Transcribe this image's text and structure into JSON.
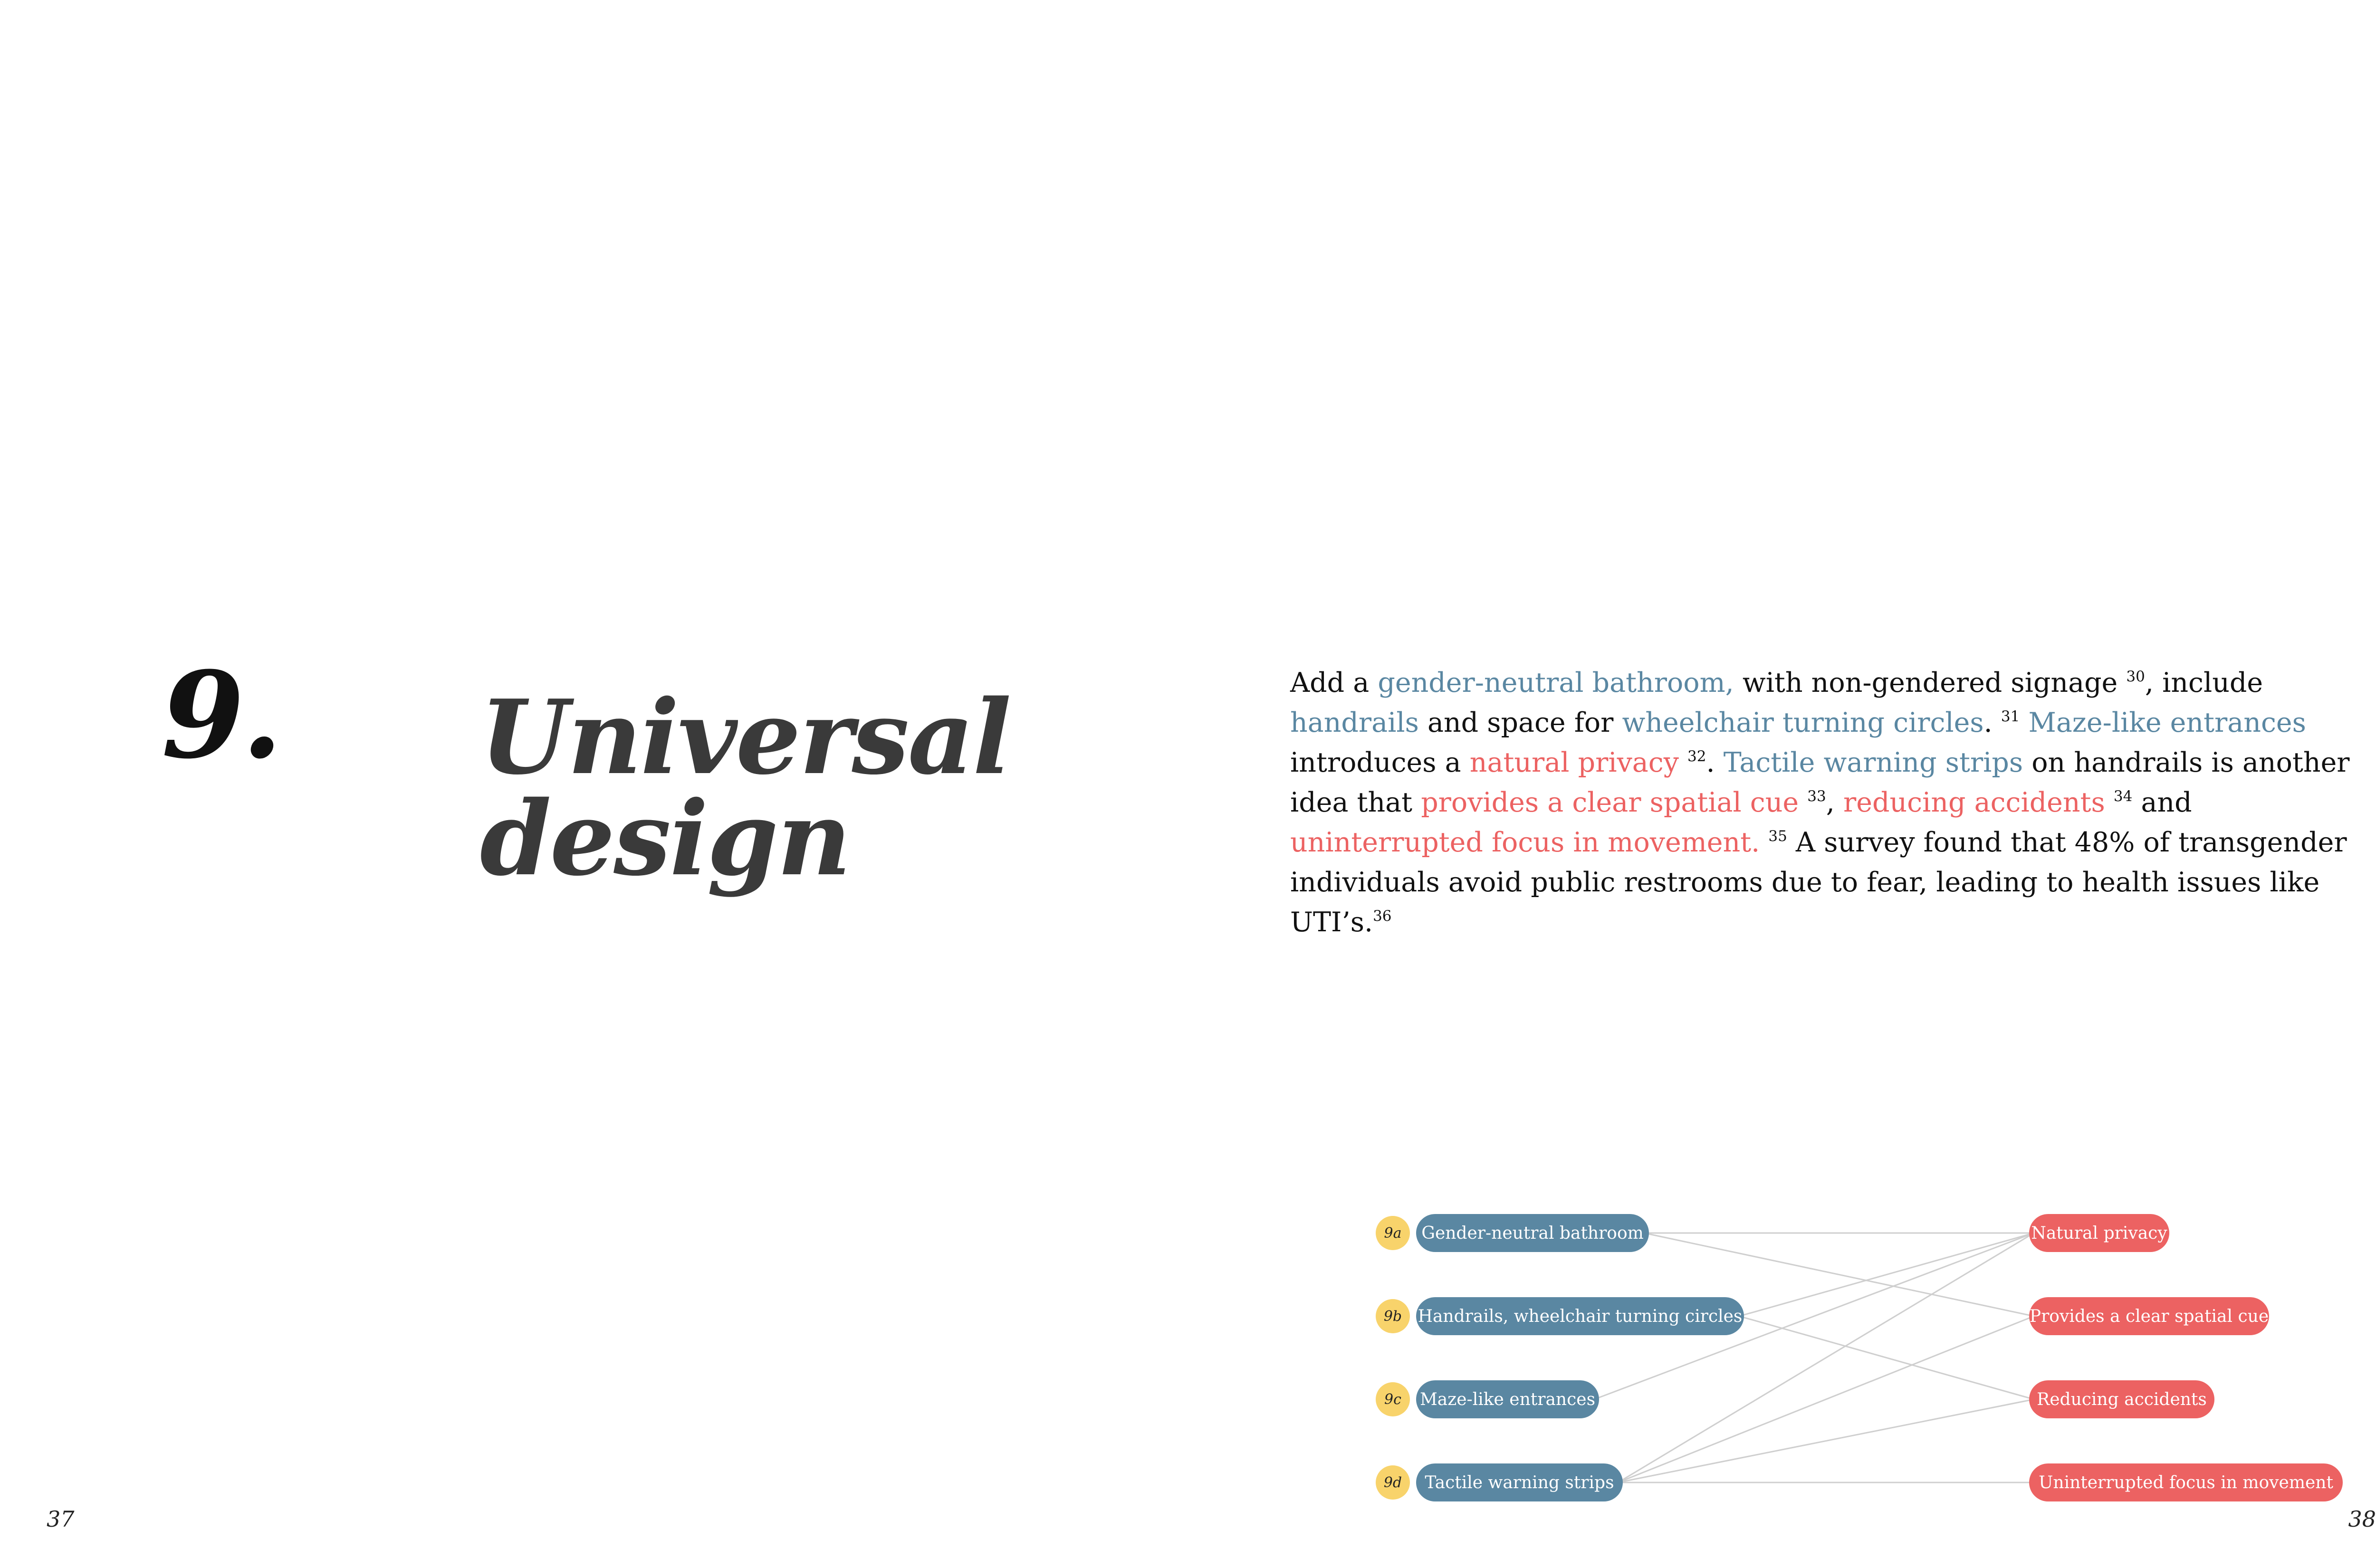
{
  "chapter": {
    "number": "9.",
    "title_line1": "Universal",
    "title_line2": "design"
  },
  "body": {
    "s01": "Add a ",
    "s02": "gender-neutral bathroom,",
    "s03": " with non-gendered signage ",
    "n30": "30",
    "s04": ", include ",
    "s05": "handrails",
    "s06": " and space for ",
    "s07": "wheelchair turning circles",
    "s08": ". ",
    "n31": "31",
    "s09": " ",
    "s10": "Maze-like entrances",
    "s11": " introduces a ",
    "s12": "natural privacy",
    "s13": " ",
    "n32": "32",
    "s14": ". ",
    "s15": "Tactile warning strips",
    "s16": " on handrails is another idea that ",
    "s17": "provides a clear spatial cue",
    "s18": " ",
    "n33": "33",
    "s19": ", ",
    "s20": "reducing accidents",
    "s21": " ",
    "n34": "34",
    "s22": " and ",
    "s23": "uninterrupted focus in movement.",
    "s24": " ",
    "n35": "35",
    "s25": "  A survey found that 48% of transgender individuals avoid public restrooms due to fear, leading to health issues like UTI’s.",
    "n36": "36"
  },
  "diagram": {
    "left_nodes": [
      {
        "tag": "9a",
        "label": "Gender-neutral bathroom"
      },
      {
        "tag": "9b",
        "label": "Handrails, wheelchair turning circles"
      },
      {
        "tag": "9c",
        "label": "Maze-like entrances"
      },
      {
        "tag": "9d",
        "label": "Tactile warning strips"
      }
    ],
    "right_nodes": [
      {
        "label": "Natural privacy"
      },
      {
        "label": "Provides a clear spatial cue"
      },
      {
        "label": "Reducing accidents"
      },
      {
        "label": "Uninterrupted focus in movement"
      }
    ],
    "links": [
      [
        0,
        0
      ],
      [
        0,
        1
      ],
      [
        1,
        0
      ],
      [
        1,
        2
      ],
      [
        2,
        0
      ],
      [
        3,
        0
      ],
      [
        3,
        1
      ],
      [
        3,
        2
      ],
      [
        3,
        3
      ]
    ],
    "colors": {
      "left": "#5a87a2",
      "right": "#ec6262",
      "tag": "#f8d36b",
      "link": "#cfcfcf"
    }
  },
  "pages": {
    "left": "37",
    "right": "38"
  }
}
